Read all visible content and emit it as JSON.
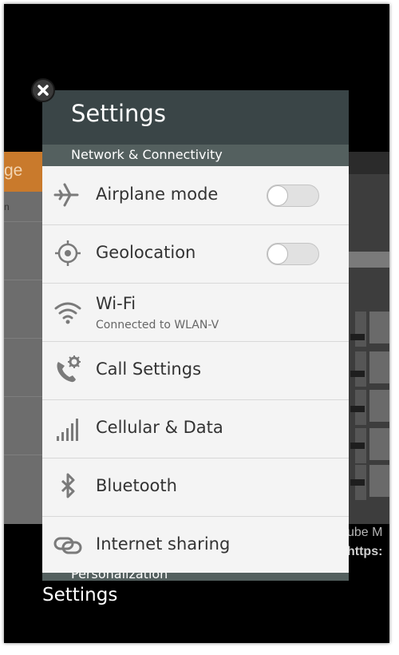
{
  "app": {
    "card_title": "Settings",
    "caption": "Settings"
  },
  "section": {
    "network": "Network & Connectivity",
    "next": "Personalization"
  },
  "items": [
    {
      "label": "Airplane mode",
      "icon": "airplane-icon",
      "toggle": "off"
    },
    {
      "label": "Geolocation",
      "icon": "crosshair-icon",
      "toggle": "off"
    },
    {
      "label": "Wi-Fi",
      "sub": "Connected to WLAN-V",
      "icon": "wifi-icon"
    },
    {
      "label": "Call Settings",
      "icon": "phone-gear-icon"
    },
    {
      "label": "Cellular & Data",
      "icon": "signal-bars-icon"
    },
    {
      "label": "Bluetooth",
      "icon": "bluetooth-icon"
    },
    {
      "label": "Internet sharing",
      "icon": "link-icon"
    }
  ],
  "background": {
    "left_header": "ge",
    "left_row": "n",
    "right_line1": "ube M",
    "right_line2": "https:"
  },
  "colors": {
    "header": "#3a4547",
    "section": "#54605f",
    "list_bg": "#f4f4f4",
    "icon": "#7a7a7a"
  }
}
